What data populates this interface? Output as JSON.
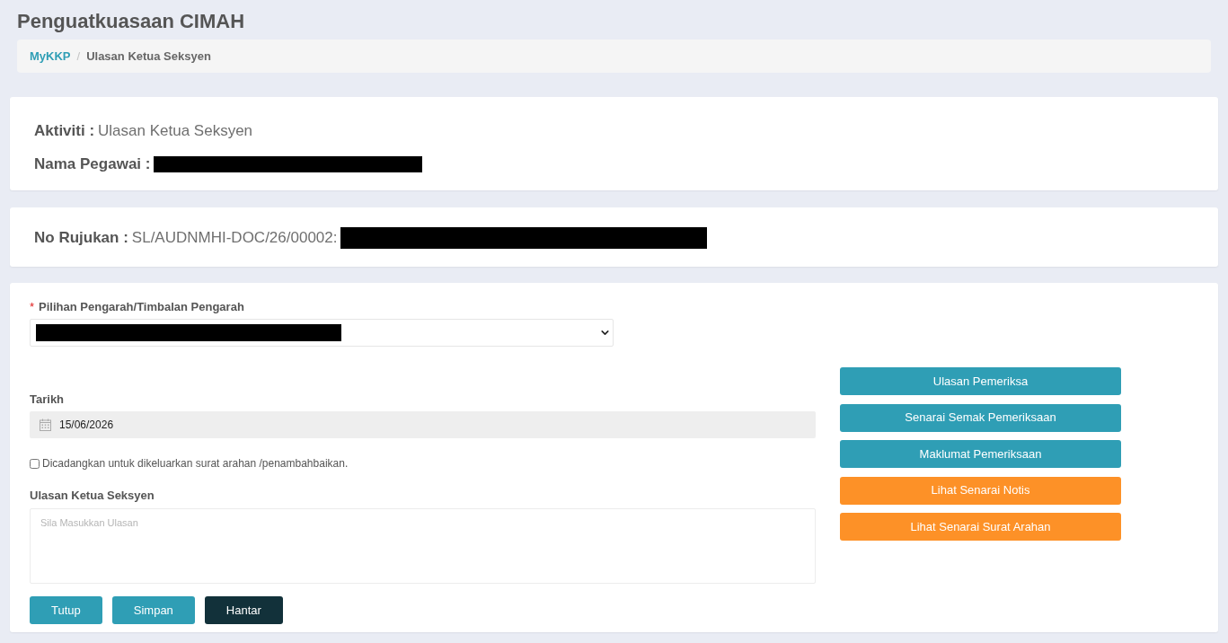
{
  "page_title": "Penguatkuasaan CIMAH",
  "breadcrumb": {
    "separator": "/",
    "items": [
      {
        "label": "MyKKP",
        "kind": "link"
      },
      {
        "label": "Ulasan Ketua Seksyen",
        "kind": "current"
      }
    ]
  },
  "activity_card": {
    "fields": [
      {
        "label": "Aktiviti :",
        "value": "Ulasan Ketua Seksyen"
      },
      {
        "label": "Nama Pegawai :",
        "redacted": true
      }
    ]
  },
  "reference_card": {
    "label": "No Rujukan :",
    "value": "SL/AUDNMHI-DOC/26/00002:",
    "redacted": true
  },
  "form": {
    "director_select": {
      "required_mark": "*",
      "label": "Pilihan Pengarah/Timbalan Pengarah",
      "redacted": true
    },
    "date": {
      "label": "Tarikh",
      "value": "15/06/2026"
    },
    "recommend_checkbox": {
      "label": "Dicadangkan untuk dikeluarkan surat arahan /penambahbaikan.",
      "checked": false
    },
    "comment": {
      "label": "Ulasan Ketua Seksyen",
      "placeholder": "Sila Masukkan Ulasan"
    },
    "buttons": [
      {
        "label": "Tutup",
        "kind": "info"
      },
      {
        "label": "Simpan",
        "kind": "info"
      },
      {
        "label": "Hantar",
        "kind": "dark"
      }
    ]
  },
  "side_buttons": [
    {
      "label": "Ulasan Pemeriksa",
      "kind": "info"
    },
    {
      "label": "Senarai Semak Pemeriksaan",
      "kind": "info"
    },
    {
      "label": "Maklumat Pemeriksaan",
      "kind": "info"
    },
    {
      "label": "Lihat Senarai Notis",
      "kind": "warning"
    },
    {
      "label": "Lihat Senarai Surat Arahan",
      "kind": "warning"
    }
  ]
}
